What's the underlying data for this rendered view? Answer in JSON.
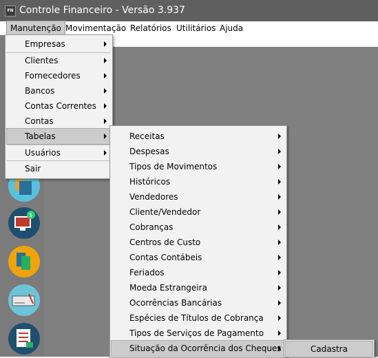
{
  "window": {
    "title": "Controle Financeiro - Versão 3.937",
    "icon_text": "FN"
  },
  "menubar": [
    {
      "label": "Manutenção"
    },
    {
      "label": "Movimentação"
    },
    {
      "label": "Relatórios"
    },
    {
      "label": "Utilitários"
    },
    {
      "label": "Ajuda"
    }
  ],
  "manutencao_menu": [
    {
      "label": "Empresas",
      "submenu": true
    },
    {
      "label": "Clientes",
      "submenu": true
    },
    {
      "label": "Fornecedores",
      "submenu": true
    },
    {
      "label": "Bancos",
      "submenu": true
    },
    {
      "label": "Contas Correntes",
      "submenu": true
    },
    {
      "label": "Contas",
      "submenu": true
    },
    {
      "label": "Tabelas",
      "submenu": true
    },
    {
      "label": "Usuários",
      "submenu": true
    },
    {
      "label": "Sair",
      "submenu": false
    }
  ],
  "tabelas_menu": [
    {
      "label": "Receitas"
    },
    {
      "label": "Despesas"
    },
    {
      "label": "Tipos de Movimentos"
    },
    {
      "label": "Históricos"
    },
    {
      "label": "Vendedores"
    },
    {
      "label": "Cliente/Vendedor"
    },
    {
      "label": "Cobranças"
    },
    {
      "label": "Centros de Custo"
    },
    {
      "label": "Contas Contábeis"
    },
    {
      "label": "Feriados"
    },
    {
      "label": "Moeda Estrangeira"
    },
    {
      "label": "Ocorrências Bancárias"
    },
    {
      "label": "Espécies de Títulos de Cobrança"
    },
    {
      "label": "Tipos de Serviços de Pagamento"
    },
    {
      "label": "Situação da Ocorrência dos Cheques"
    }
  ],
  "situacao_menu": [
    {
      "label": "Cadastra"
    }
  ],
  "sidebar_icons": [
    {
      "name": "folders-icon",
      "color": "#5bc0de"
    },
    {
      "name": "monitor-money-icon",
      "color": "#1e4f6e"
    },
    {
      "name": "documents-icon",
      "color": "#f0a30a"
    },
    {
      "name": "check-icon",
      "color": "#6fc3d9"
    },
    {
      "name": "checklist-icon",
      "color": "#1e4f6e"
    }
  ]
}
